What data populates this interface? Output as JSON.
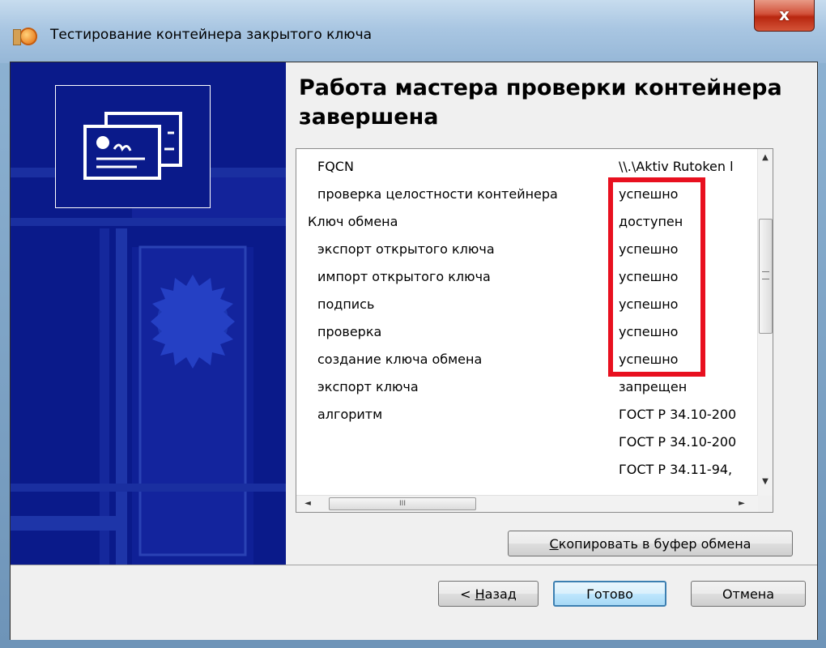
{
  "window": {
    "title": "Тестирование контейнера закрытого ключа",
    "close_glyph": "x"
  },
  "heading": "Работа мастера проверки контейнера завершена",
  "results": [
    {
      "label": "FQCN",
      "value": "\\\\.\\Aktiv Rutoken l"
    },
    {
      "label": "проверка целостности контейнера",
      "value": "успешно"
    },
    {
      "label": "Ключ обмена",
      "value": "доступен"
    },
    {
      "label": "экспорт открытого ключа",
      "value": "успешно"
    },
    {
      "label": "импорт открытого ключа",
      "value": "успешно"
    },
    {
      "label": "подпись",
      "value": "успешно"
    },
    {
      "label": "проверка",
      "value": "успешно"
    },
    {
      "label": "создание ключа обмена",
      "value": "успешно"
    },
    {
      "label": "экспорт ключа",
      "value": "запрещен"
    },
    {
      "label": "алгоритм",
      "value": "ГОСТ Р 34.10-200"
    },
    {
      "label": "",
      "value": "ГОСТ Р 34.10-200"
    },
    {
      "label": "",
      "value": "ГОСТ Р 34.11-94,"
    }
  ],
  "scroll": {
    "up": "▲",
    "down": "▼",
    "left": "◄",
    "right": "►",
    "grip": "III",
    "vgrip": "≡"
  },
  "buttons": {
    "copy": {
      "accel": "С",
      "rest": "копировать в буфер обмена"
    },
    "back": {
      "prefix": "< ",
      "accel": "Н",
      "rest": "азад"
    },
    "done": "Готово",
    "cancel": "Отмена"
  },
  "colors": {
    "banner": "#0a1a8a",
    "highlight": "#e8101f"
  }
}
